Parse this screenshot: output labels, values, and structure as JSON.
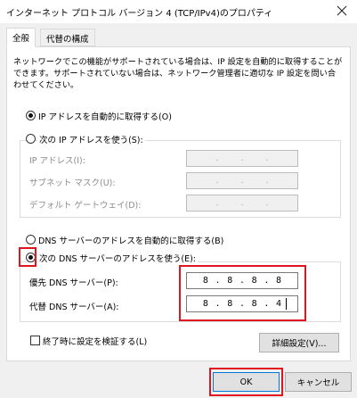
{
  "window": {
    "title": "インターネット プロトコル バージョン 4 (TCP/IPv4)のプロパティ",
    "close_icon": "close-icon"
  },
  "tabs": [
    {
      "label": "全般",
      "active": true
    },
    {
      "label": "代替の構成",
      "active": false
    }
  ],
  "description": "ネットワークでこの機能がサポートされている場合は、IP 設定を自動的に取得することができます。サポートされていない場合は、ネットワーク管理者に適切な IP 設定を問い合わせてください。",
  "ip": {
    "auto_label": "IP アドレスを自動的に取得する(O)",
    "auto_selected": true,
    "manual_label": "次の IP アドレスを使う(S):",
    "manual_selected": false,
    "fields": [
      {
        "label": "IP アドレス(I):",
        "value": [
          "",
          "",
          "",
          ""
        ]
      },
      {
        "label": "サブネット マスク(U):",
        "value": [
          "",
          "",
          "",
          ""
        ]
      },
      {
        "label": "デフォルト ゲートウェイ(D):",
        "value": [
          "",
          "",
          "",
          ""
        ]
      }
    ],
    "separator": "."
  },
  "dns": {
    "auto_label": "DNS サーバーのアドレスを自動的に取得する(B)",
    "auto_selected": false,
    "manual_label": "次の DNS サーバーのアドレスを使う(E):",
    "manual_selected": true,
    "preferred_label": "優先 DNS サーバー(P):",
    "preferred_value": [
      "8",
      "8",
      "8",
      "8"
    ],
    "alternate_label": "代替 DNS サーバー(A):",
    "alternate_value": [
      "8",
      "8",
      "8",
      "4"
    ]
  },
  "validate": {
    "label": "終了時に設定を検証する(L)",
    "checked": false
  },
  "buttons": {
    "advanced": "詳細設定(V)...",
    "ok": "OK",
    "cancel": "キャンセル"
  },
  "colors": {
    "highlight": "#e0141e",
    "dialog_bg": "#f0f0f0",
    "accent": "#0078d7"
  }
}
